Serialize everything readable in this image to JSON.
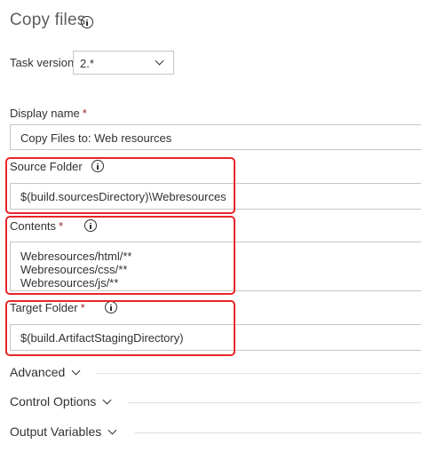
{
  "title": "Copy files",
  "task_version": {
    "label": "Task version",
    "value": "2.*"
  },
  "display_name": {
    "label": "Display name",
    "required_mark": "*",
    "value": "Copy Files to: Web resources"
  },
  "source_folder": {
    "label": "Source Folder",
    "value": "$(build.sourcesDirectory)\\Webresources"
  },
  "contents": {
    "label": "Contents",
    "required_mark": "*",
    "lines": [
      "Webresources/html/**",
      "Webresources/css/**",
      "Webresources/js/**"
    ]
  },
  "target_folder": {
    "label": "Target Folder",
    "required_mark": "*",
    "value": "$(build.ArtifactStagingDirectory)"
  },
  "sections": {
    "advanced": "Advanced",
    "control_options": "Control Options",
    "output_variables": "Output Variables"
  },
  "colors": {
    "highlight": "#e8252a",
    "required": "#a4262c",
    "border": "#c8c6c4"
  }
}
